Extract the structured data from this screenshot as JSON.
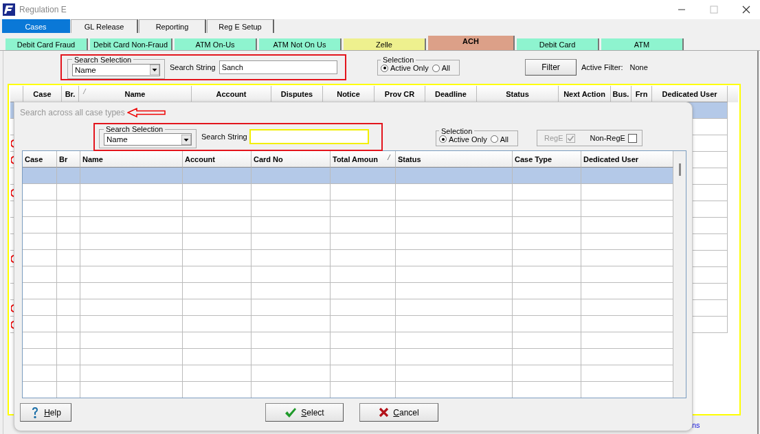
{
  "window": {
    "title": "Regulation E"
  },
  "main_tabs": [
    {
      "label": "Cases",
      "selected": true
    },
    {
      "label": "GL Release",
      "selected": false
    },
    {
      "label": "Reporting",
      "selected": false
    },
    {
      "label": "Reg E Setup",
      "selected": false
    }
  ],
  "case_tabs": [
    {
      "label": "Debit Card Fraud",
      "selected": false,
      "color": "#8ef4cf"
    },
    {
      "label": "Debit Card Non-Fraud",
      "selected": false,
      "color": "#8ef4cf"
    },
    {
      "label": "ATM On-Us",
      "selected": false,
      "color": "#8ef4cf"
    },
    {
      "label": "ATM Not On Us",
      "selected": false,
      "color": "#8ef4cf"
    },
    {
      "label": "Zelle",
      "selected": false,
      "color": "#eef08e"
    },
    {
      "label": "ACH",
      "selected": true,
      "color": "#dca088"
    },
    {
      "label": "Debit Card",
      "selected": false,
      "color": "#8ef4cf"
    },
    {
      "label": "ATM",
      "selected": false,
      "color": "#8ef4cf"
    }
  ],
  "search": {
    "group_label": "Search Selection",
    "selection": "Name",
    "string_label": "Search String",
    "value": "Sanch"
  },
  "selection": {
    "group_label": "Selection",
    "options": [
      {
        "label": "Active Only",
        "selected": true
      },
      {
        "label": "All",
        "selected": false
      }
    ]
  },
  "filter": {
    "button": "Filter",
    "label": "Active Filter:",
    "value": "None"
  },
  "cases_table": {
    "columns": [
      "",
      "Case",
      "Br.",
      "Name",
      "Account",
      "Disputes",
      "Notice",
      "Prov CR",
      "Deadline",
      "Status",
      "Next Action",
      "Bus.",
      "Frn",
      "Dedicated User"
    ],
    "rows": [
      {
        "selected": true,
        "flagged": false
      },
      {
        "selected": false,
        "flagged": false
      },
      {
        "selected": false,
        "flagged": true
      },
      {
        "selected": false,
        "flagged": true
      },
      {
        "selected": false,
        "flagged": false
      },
      {
        "selected": false,
        "flagged": true
      },
      {
        "selected": false,
        "flagged": false
      },
      {
        "selected": false,
        "flagged": false
      },
      {
        "selected": false,
        "flagged": false
      },
      {
        "selected": false,
        "flagged": true
      },
      {
        "selected": false,
        "flagged": false
      },
      {
        "selected": false,
        "flagged": false
      },
      {
        "selected": false,
        "flagged": true
      },
      {
        "selected": false,
        "flagged": true
      }
    ]
  },
  "status_link": "ns",
  "search_dialog": {
    "caption": "Search across all case types",
    "search": {
      "group_label": "Search Selection",
      "selection": "Name",
      "string_label": "Search String"
    },
    "selection": {
      "group_label": "Selection",
      "options": [
        {
          "label": "Active Only",
          "selected": true
        },
        {
          "label": "All",
          "selected": false
        }
      ]
    },
    "type_filters": [
      {
        "label": "RegE",
        "checked": true,
        "disabled": true
      },
      {
        "label": "Non-RegE",
        "checked": false,
        "disabled": false
      }
    ],
    "results": {
      "columns": [
        "Case",
        "Br",
        "Name",
        "Account",
        "Card No",
        "Total Amoun",
        "Status",
        "Case Type",
        "Dedicated User"
      ],
      "rows": [
        {
          "selected": true
        },
        {
          "selected": false
        },
        {
          "selected": false
        },
        {
          "selected": false
        },
        {
          "selected": false
        },
        {
          "selected": false
        },
        {
          "selected": false
        },
        {
          "selected": false
        },
        {
          "selected": false
        },
        {
          "selected": false
        },
        {
          "selected": false
        },
        {
          "selected": false
        },
        {
          "selected": false
        },
        {
          "selected": false
        }
      ]
    },
    "buttons": [
      {
        "kind": "help",
        "label": "Help"
      },
      {
        "kind": "select",
        "label": "Select"
      },
      {
        "kind": "cancel",
        "label": "Cancel"
      }
    ]
  }
}
